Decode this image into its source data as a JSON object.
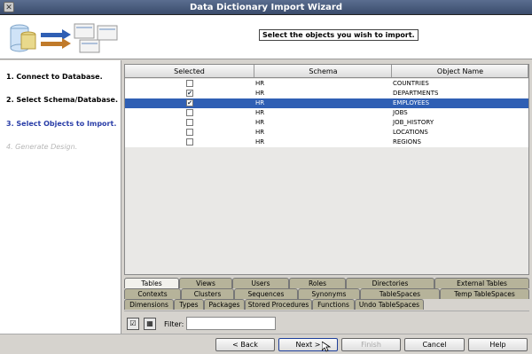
{
  "window": {
    "title": "Data Dictionary Import Wizard",
    "close_glyph": "✕"
  },
  "header": {
    "instruction": "Select the objects you wish to import."
  },
  "steps": [
    {
      "label": "1. Connect to Database.",
      "state": "done"
    },
    {
      "label": "2. Select Schema/Database.",
      "state": "done"
    },
    {
      "label": "3. Select Objects to Import.",
      "state": "active"
    },
    {
      "label": "4. Generate Design.",
      "state": "disabled"
    }
  ],
  "grid": {
    "columns": [
      "Selected",
      "Schema",
      "Object Name"
    ],
    "rows": [
      {
        "selected": false,
        "schema": "HR",
        "object": "COUNTRIES",
        "highlight": false
      },
      {
        "selected": true,
        "schema": "HR",
        "object": "DEPARTMENTS",
        "highlight": false
      },
      {
        "selected": true,
        "schema": "HR",
        "object": "EMPLOYEES",
        "highlight": true
      },
      {
        "selected": false,
        "schema": "HR",
        "object": "JOBS",
        "highlight": false
      },
      {
        "selected": false,
        "schema": "HR",
        "object": "JOB_HISTORY",
        "highlight": false
      },
      {
        "selected": false,
        "schema": "HR",
        "object": "LOCATIONS",
        "highlight": false
      },
      {
        "selected": false,
        "schema": "HR",
        "object": "REGIONS",
        "highlight": false
      }
    ]
  },
  "tabs": {
    "row1": [
      "Tables",
      "Views",
      "Users",
      "Roles",
      "Directories",
      "External Tables"
    ],
    "row2": [
      "Contexts",
      "Clusters",
      "Sequences",
      "Synonyms",
      "TableSpaces",
      "Temp TableSpaces"
    ],
    "row3": [
      "Dimensions",
      "Types",
      "Packages",
      "Stored Procedures",
      "Functions",
      "Undo TableSpaces"
    ],
    "active": "Tables"
  },
  "filter": {
    "label": "Filter:",
    "value": ""
  },
  "buttons": {
    "back": "< Back",
    "next": "Next >",
    "finish": "Finish",
    "cancel": "Cancel",
    "help": "Help"
  },
  "colors": {
    "selection": "#2f5fb4",
    "active_step": "#2a3ea8"
  }
}
